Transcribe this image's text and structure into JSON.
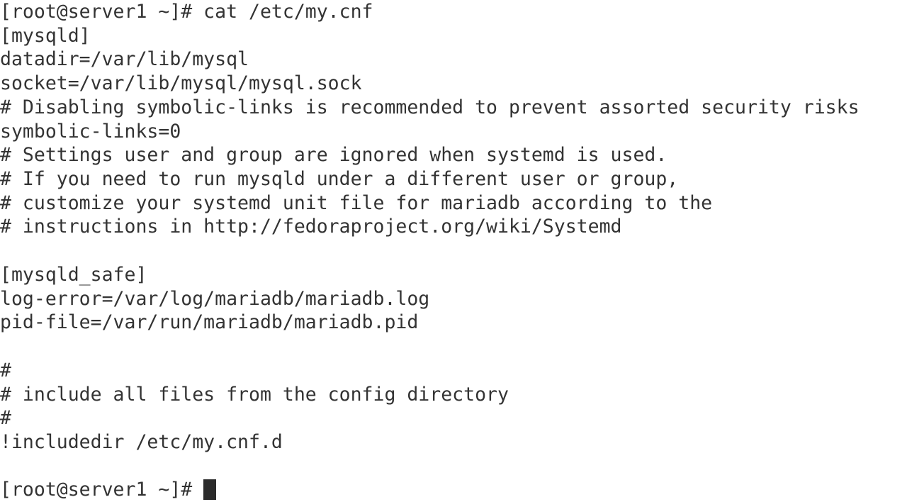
{
  "terminal": {
    "background_color": "#ffffff",
    "text_color": "#333333",
    "cursor_color": "#2b2b2b",
    "prompt": "[root@server1 ~]#",
    "command": "cat /etc/my.cnf",
    "file_path": "/etc/my.cnf",
    "cursor_glyph": "block-cursor",
    "lines": [
      "[root@server1 ~]# cat /etc/my.cnf",
      "[mysqld]",
      "datadir=/var/lib/mysql",
      "socket=/var/lib/mysql/mysql.sock",
      "# Disabling symbolic-links is recommended to prevent assorted security risks",
      "symbolic-links=0",
      "# Settings user and group are ignored when systemd is used.",
      "# If you need to run mysqld under a different user or group,",
      "# customize your systemd unit file for mariadb according to the",
      "# instructions in http://fedoraproject.org/wiki/Systemd",
      "",
      "[mysqld_safe]",
      "log-error=/var/log/mariadb/mariadb.log",
      "pid-file=/var/run/mariadb/mariadb.pid",
      "",
      "#",
      "# include all files from the config directory",
      "#",
      "!includedir /etc/my.cnf.d",
      "",
      "[root@server1 ~]# "
    ]
  }
}
